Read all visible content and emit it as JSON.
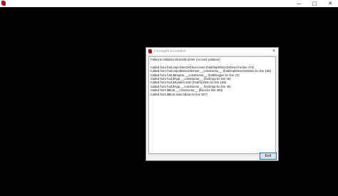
{
  "window": {
    "minimize_glyph": "—",
    "maximize_glyph": "□",
    "close_glyph": "✕"
  },
  "dialog": {
    "title": "Uncaught Exception",
    "close_glyph": "✕",
    "message": "Failed to initialize Direct3D driver (Access violation)",
    "trace": [
      "Called from h3d.impl.DirectXDriver.reset (h3d/impl/DirectXDriver.hx line 172)",
      "Called from h3d.impl.$DirectXDriver.__constructor__ (h3d/impl/DirectXDriver.hx line 136)",
      "Called from h3d.$Engine.__constructor__ (h3d/Engine.hx line 72)",
      "Called from hxd.$App.__constructor__ (hxd/App.hx line 46)",
      "Called from hxd.$System.start (hxd/System.hx line 109)",
      "Called from hxd.$App.__constructor__ (hxd/App.hx line 45)",
      "Called from $Boot.__constructor__ (Boot.hx line 363)",
      "Called from $Boot.main (Boot.hx line 357)"
    ],
    "exit_label": "Exit"
  },
  "colors": {
    "client_bg": "#000000",
    "accent_border": "#0078d7",
    "app_icon": "#b5122a"
  }
}
